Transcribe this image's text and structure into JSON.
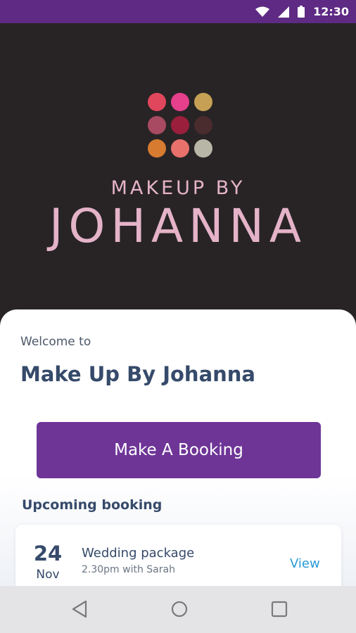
{
  "status_bar": {
    "time": "12:30",
    "background": "#5e2a84",
    "icons": [
      "wifi-icon",
      "signal-icon",
      "battery-icon"
    ]
  },
  "hero": {
    "brand_line1": "MAKEUP BY",
    "brand_line2": "JOHANNA",
    "palette_colors": [
      "#e0475d",
      "#e63f8c",
      "#c6a054",
      "#a84b62",
      "#9a1f3c",
      "#4a2b2e",
      "#d77b30",
      "#e8716b",
      "#b8b6a6"
    ]
  },
  "welcome": {
    "greeting": "Welcome to",
    "title": "Make Up By Johanna"
  },
  "booking_button": {
    "label": "Make A Booking",
    "color": "#6e3597"
  },
  "upcoming": {
    "heading": "Upcoming booking",
    "items": [
      {
        "day": "24",
        "month": "Nov",
        "title": "Wedding package",
        "detail": "2.30pm with Sarah",
        "action": "View"
      }
    ]
  },
  "nav_bar": {
    "buttons": [
      "back-icon",
      "home-icon",
      "recents-icon"
    ]
  }
}
